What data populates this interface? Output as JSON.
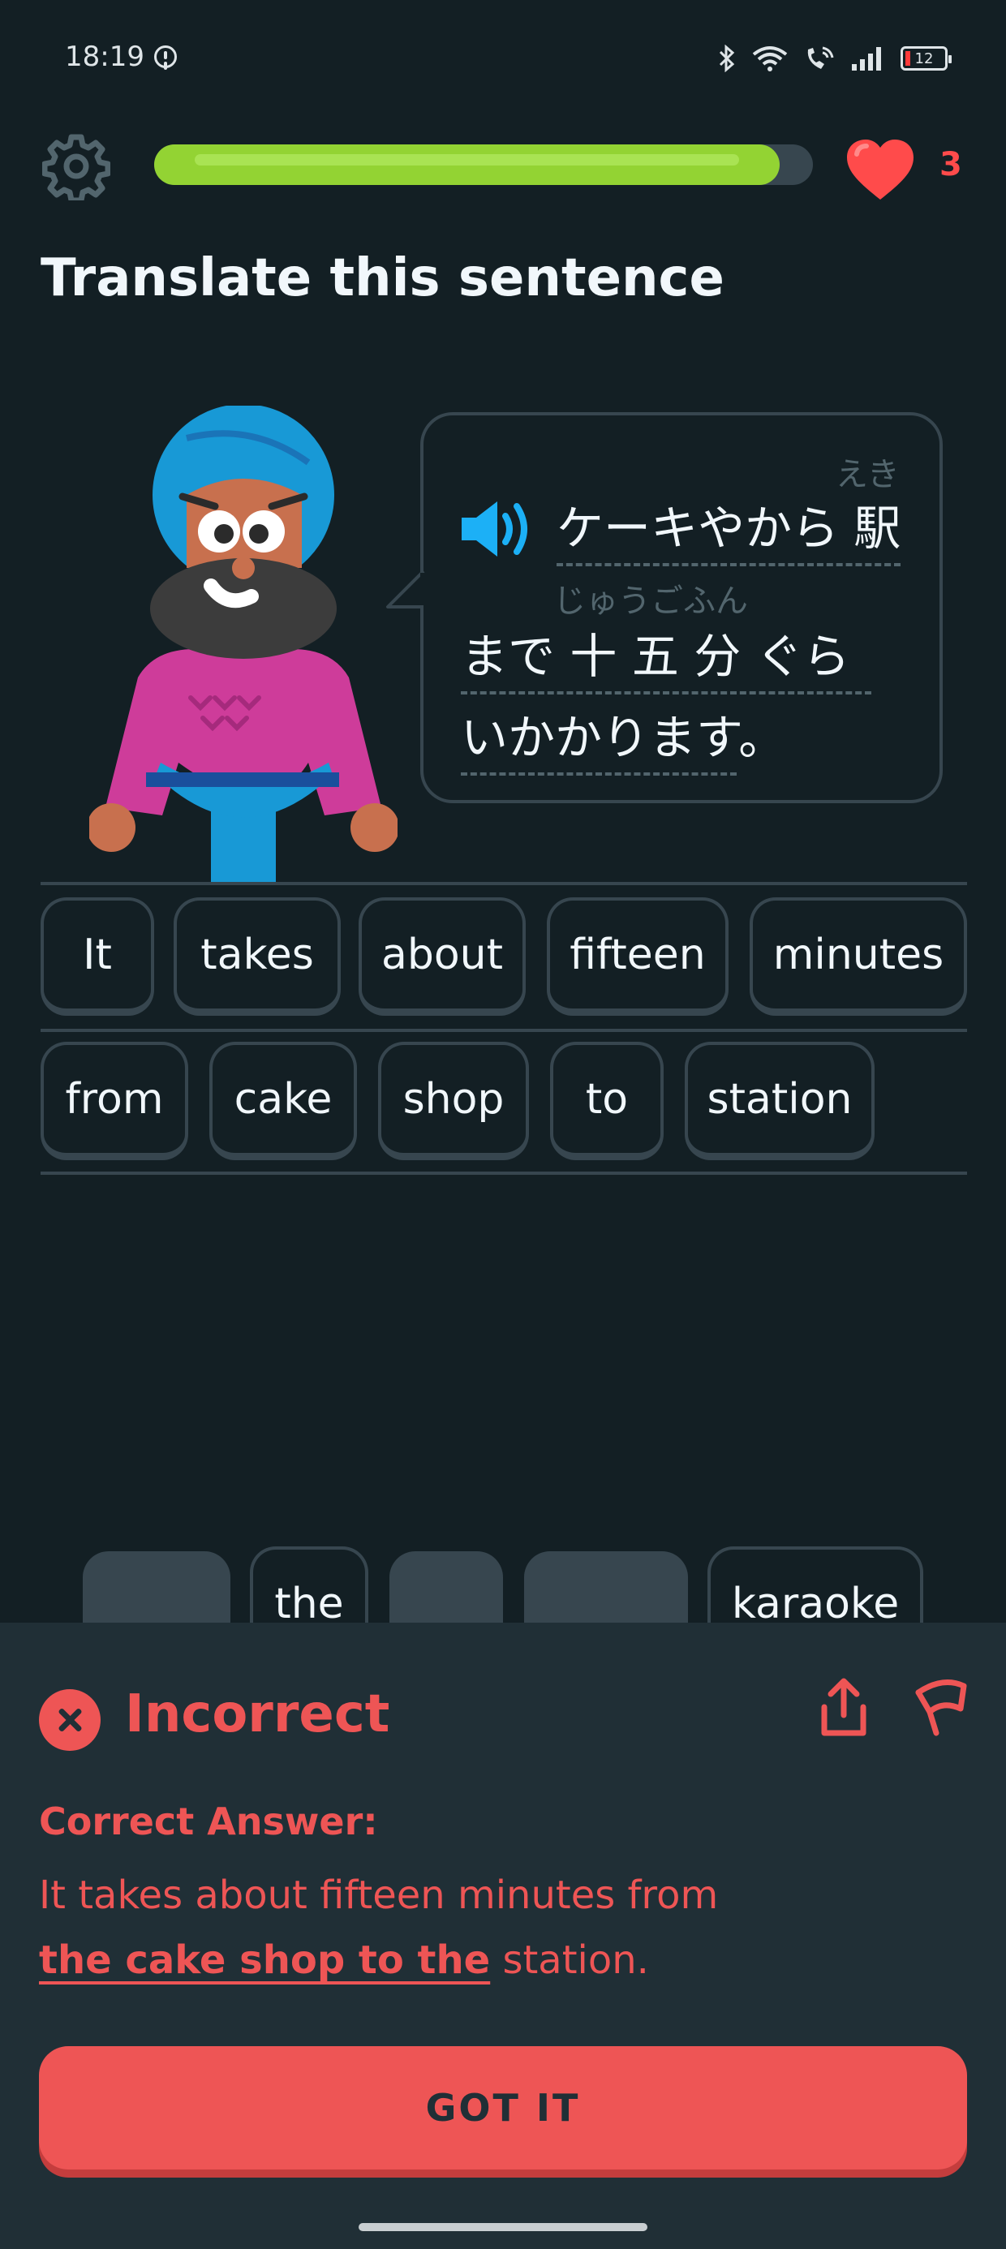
{
  "status_bar": {
    "time": "18:19",
    "battery": "12",
    "icons": [
      "alert-icon",
      "bluetooth-icon",
      "wifi-icon",
      "wifi-calling-icon",
      "signal-icon",
      "battery-icon"
    ]
  },
  "header": {
    "progress_fraction": 0.95,
    "hearts": "3"
  },
  "prompt": {
    "title": "Translate this sentence",
    "lines": [
      {
        "ruby": "えき",
        "text": "ケーキやから 駅"
      },
      {
        "ruby": "じゅうごふん",
        "text": "まで 十 五 分 ぐら"
      },
      {
        "ruby": "",
        "text": "いかかります。"
      }
    ]
  },
  "answer_chips": {
    "row1": [
      "It",
      "takes",
      "about",
      "fifteen",
      "minutes"
    ],
    "row2": [
      "from",
      "cake",
      "shop",
      "to",
      "station"
    ]
  },
  "word_bank": {
    "visible": [
      "the",
      "karaoke"
    ]
  },
  "feedback": {
    "status": "Incorrect",
    "correct_label": "Correct Answer:",
    "answer_line1": "It takes about fifteen minutes from",
    "answer_highlight": "the cake shop to the",
    "answer_tail": " station.",
    "button": "GOT IT"
  },
  "colors": {
    "background": "#131f24",
    "panel": "#202f36",
    "error": "#ee5555",
    "progress": "#93d333",
    "border": "#37464f"
  }
}
